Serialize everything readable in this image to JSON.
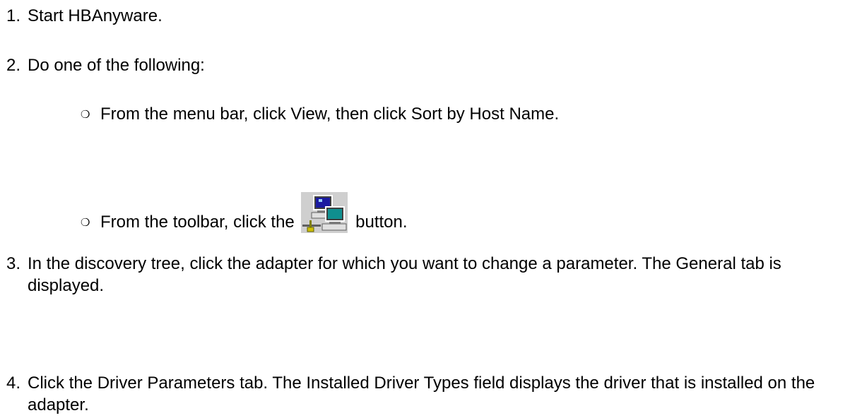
{
  "steps": [
    {
      "num": "1.",
      "text": "Start HBAnyware."
    },
    {
      "num": "2.",
      "text": "Do one of the following:"
    },
    {
      "num": "3.",
      "text": "In the discovery tree, click the adapter for which you want to change a parameter. The General tab is displayed."
    },
    {
      "num": "4.",
      "text": "Click the Driver Parameters tab. The Installed Driver Types field displays the driver that is installed on the adapter."
    }
  ],
  "substeps": {
    "bullet": "❍",
    "menu_text": "From the menu bar, click View, then click Sort by Host Name.",
    "toolbar_before": "From the toolbar, click the",
    "toolbar_after": "button."
  },
  "icons": {
    "toolbar_button_icon": "sort-by-host-name-icon"
  }
}
